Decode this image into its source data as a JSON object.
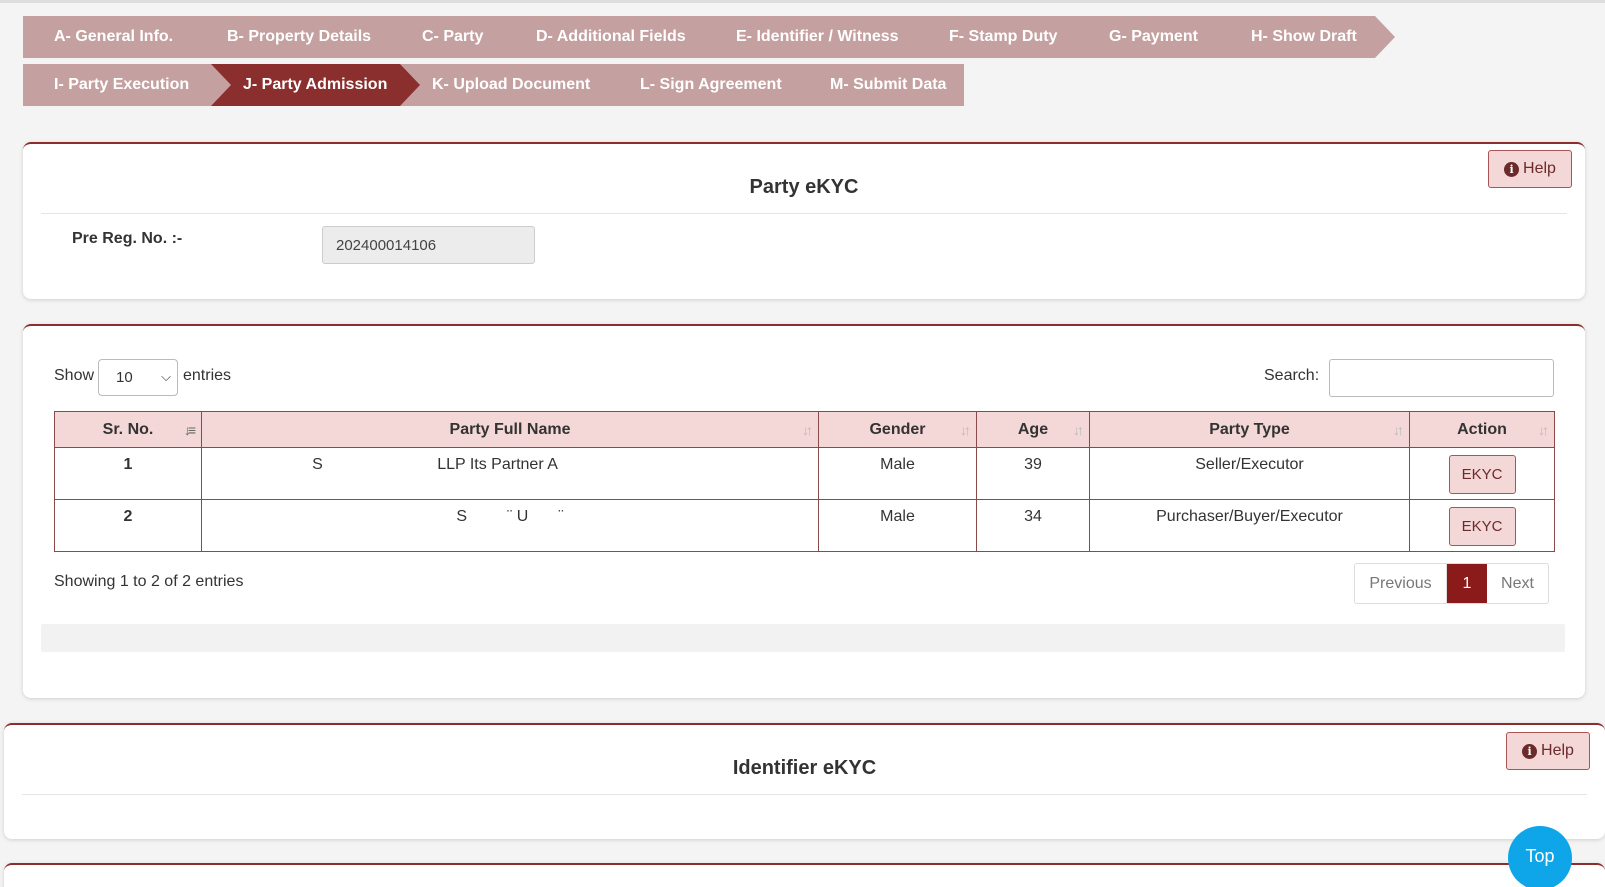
{
  "wizard": {
    "row1": [
      {
        "label": "A- General Info."
      },
      {
        "label": "B- Property Details"
      },
      {
        "label": "C- Party"
      },
      {
        "label": "D- Additional Fields"
      },
      {
        "label": "E- Identifier / Witness"
      },
      {
        "label": "F- Stamp Duty"
      },
      {
        "label": "G- Payment"
      },
      {
        "label": "H- Show Draft"
      }
    ],
    "row2": [
      {
        "label": "I- Party Execution"
      },
      {
        "label": "J- Party Admission",
        "active": true
      },
      {
        "label": "K- Upload Document"
      },
      {
        "label": "L- Sign Agreement"
      },
      {
        "label": "M- Submit Data"
      }
    ]
  },
  "party_ekyc": {
    "title": "Party eKYC",
    "help_label": "Help",
    "pre_reg_label": "Pre Reg. No. :-",
    "pre_reg_value": "202400014106"
  },
  "table_controls": {
    "show_label": "Show",
    "entries_value": "10",
    "entries_label": "entries",
    "search_label": "Search:",
    "search_value": ""
  },
  "table": {
    "headers": [
      "Sr. No.",
      "Party Full Name",
      "Gender",
      "Age",
      "Party Type",
      "Action"
    ],
    "rows": [
      {
        "sr": "1",
        "name_start": "S",
        "name_mid": "LLP Its Partner A",
        "gender": "Male",
        "age": "39",
        "type": "Seller/Executor",
        "action": "EKYC"
      },
      {
        "sr": "2",
        "name_start": "S",
        "name_mid": "¨ U",
        "name_end": "¨",
        "gender": "Male",
        "age": "34",
        "type": "Purchaser/Buyer/Executor",
        "action": "EKYC"
      }
    ],
    "info": "Showing 1 to 2 of 2 entries",
    "pager": {
      "prev": "Previous",
      "current": "1",
      "next": "Next"
    }
  },
  "identifier_ekyc": {
    "title": "Identifier eKYC",
    "help_label": "Help"
  },
  "scroll_top_label": "Top",
  "colors": {
    "accent": "#8b2e2e",
    "step_inactive": "#c5a0a0",
    "header_pink": "#f4d7d7",
    "top_button": "#0ea5e9"
  }
}
